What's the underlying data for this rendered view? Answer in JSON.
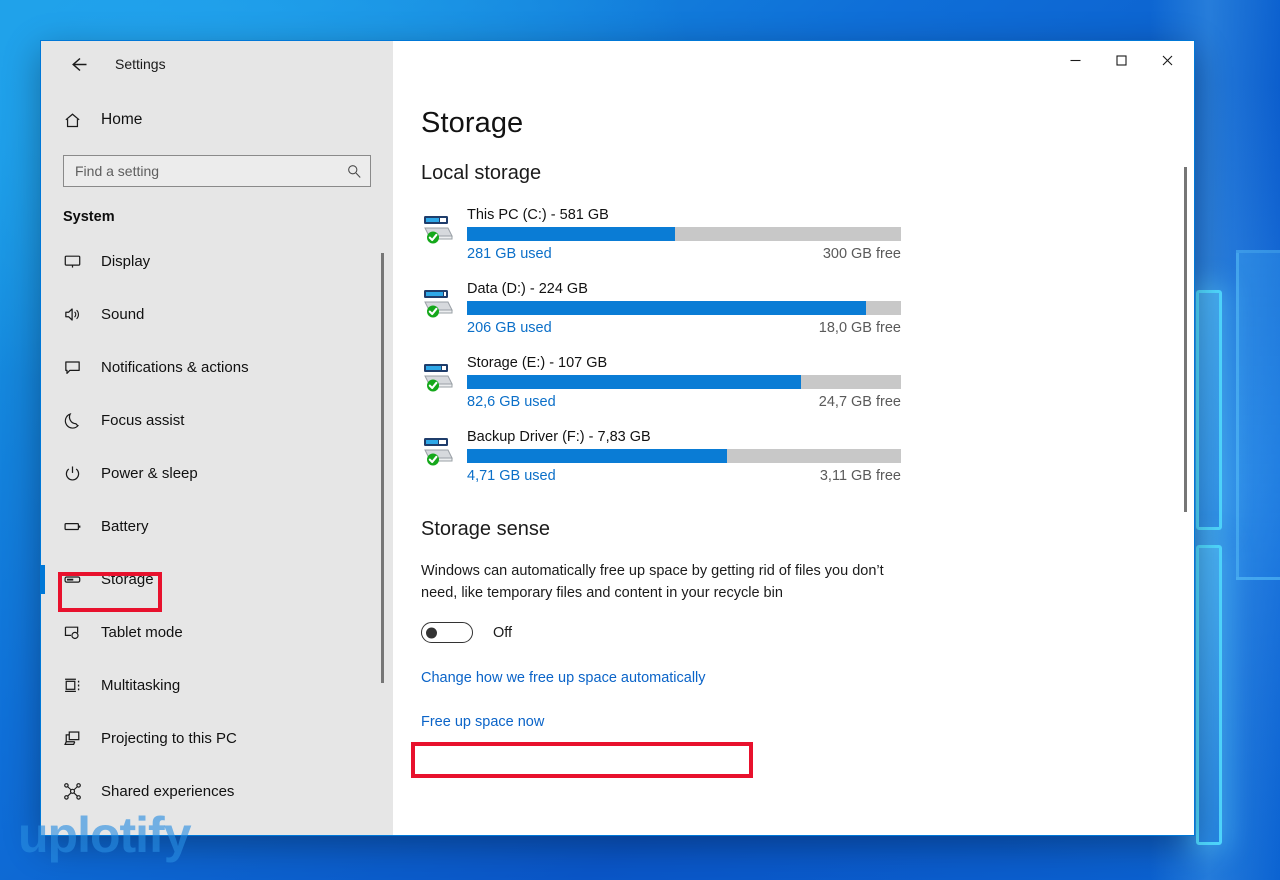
{
  "window": {
    "app_title": "Settings",
    "back_icon": "back-arrow-icon",
    "controls": {
      "minimize": "─",
      "maximize": "□",
      "close": "✕"
    }
  },
  "sidebar": {
    "home_label": "Home",
    "home_icon": "home-icon",
    "search": {
      "placeholder": "Find a setting",
      "value": "",
      "icon": "search-icon"
    },
    "group_heading": "System",
    "items": [
      {
        "label": "Display",
        "icon": "monitor-icon"
      },
      {
        "label": "Sound",
        "icon": "speaker-icon"
      },
      {
        "label": "Notifications & actions",
        "icon": "notification-icon"
      },
      {
        "label": "Focus assist",
        "icon": "moon-icon"
      },
      {
        "label": "Power & sleep",
        "icon": "power-icon"
      },
      {
        "label": "Battery",
        "icon": "battery-icon"
      },
      {
        "label": "Storage",
        "icon": "storage-icon",
        "selected": true,
        "highlighted": true
      },
      {
        "label": "Tablet mode",
        "icon": "tablet-icon"
      },
      {
        "label": "Multitasking",
        "icon": "multitasking-icon"
      },
      {
        "label": "Projecting to this PC",
        "icon": "projecting-icon"
      },
      {
        "label": "Shared experiences",
        "icon": "share-icon"
      }
    ]
  },
  "main": {
    "page_title": "Storage",
    "local_storage_heading": "Local storage",
    "drives": [
      {
        "name": "This PC (C:) - 581 GB",
        "used_label": "281 GB used",
        "free_label": "300 GB free",
        "percent_used": 48
      },
      {
        "name": "Data (D:) - 224 GB",
        "used_label": "206 GB used",
        "free_label": "18,0 GB free",
        "percent_used": 92
      },
      {
        "name": "Storage (E:) - 107 GB",
        "used_label": "82,6 GB used",
        "free_label": "24,7 GB free",
        "percent_used": 77
      },
      {
        "name": "Backup Driver (F:) - 7,83 GB",
        "used_label": "4,71 GB used",
        "free_label": "3,11 GB free",
        "percent_used": 60
      }
    ],
    "storage_sense": {
      "heading": "Storage sense",
      "description": "Windows can automatically free up space by getting rid of files you don’t need, like temporary files and content in your recycle bin",
      "toggle_state": "Off",
      "toggle_on": false,
      "link_change": "Change how we free up space automatically",
      "link_free": "Free up space now"
    }
  },
  "watermark": "uplotify",
  "colors": {
    "accent": "#0078d7",
    "bar_fill": "#0a7cd5",
    "bar_track": "#c8c8c8",
    "link": "#0b64c8",
    "highlight_box": "#e8112d",
    "sidebar_bg": "#e6e6e6"
  }
}
